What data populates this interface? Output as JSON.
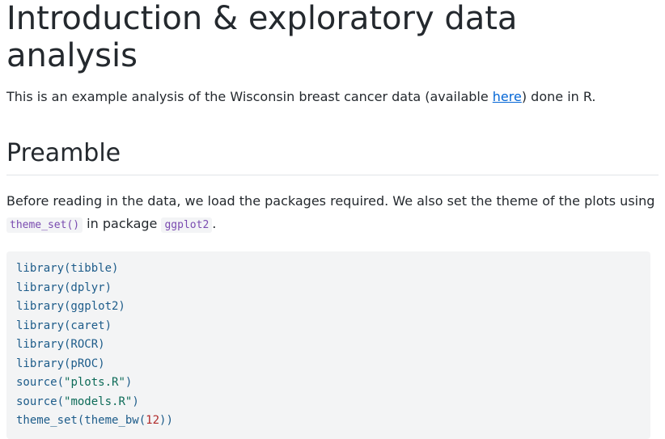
{
  "heading": "Introduction & exploratory data analysis",
  "intro": {
    "before_link": "This is an example analysis of the Wisconsin breast cancer data (available ",
    "link_text": "here",
    "after_link": ") done in R."
  },
  "section": {
    "title": "Preamble",
    "para_before": "Before reading in the data, we load the packages required. We also set the theme of the plots using ",
    "code1": "theme_set()",
    "para_mid": " in package ",
    "code2": "ggplot2",
    "para_end": "."
  },
  "code_block": {
    "lines": [
      {
        "fn": "library(tibble)"
      },
      {
        "fn": "library(dplyr)"
      },
      {
        "fn": "library(ggplot2)"
      },
      {
        "fn": "library(caret)"
      },
      {
        "fn": "library(ROCR)"
      },
      {
        "fn": "library(pROC)"
      },
      {
        "pre": "source(",
        "str": "\"plots.R\"",
        "post": ")"
      },
      {
        "pre": "source(",
        "str": "\"models.R\"",
        "post": ")"
      },
      {
        "pre": "theme_set(theme_bw(",
        "num": "12",
        "post": "))"
      }
    ]
  }
}
